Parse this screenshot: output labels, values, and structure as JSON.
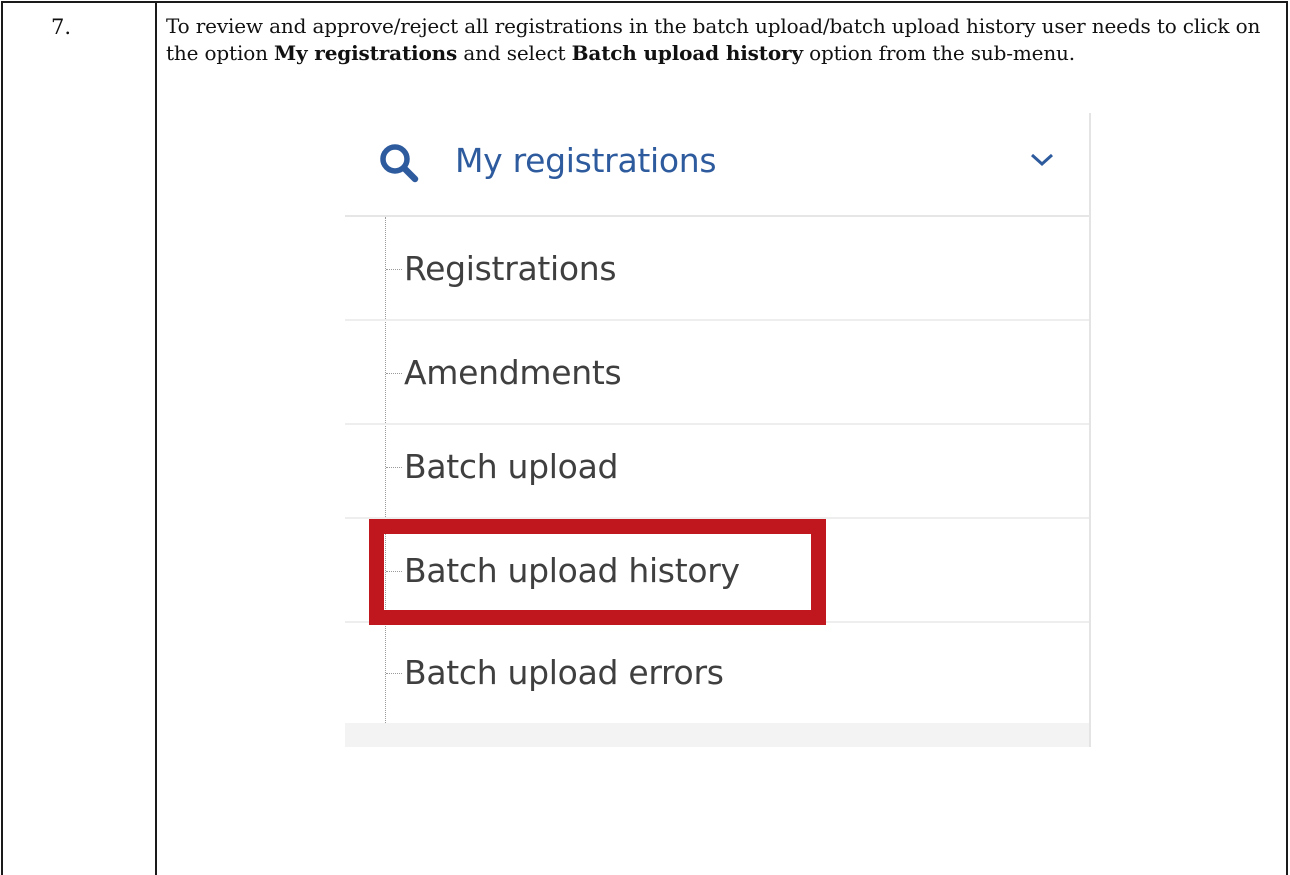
{
  "table": {
    "step_number": "7.",
    "instruction": {
      "text_1": "To review and approve/reject all registrations in the batch upload/batch upload history user needs to click on the option ",
      "bold_1": "My registrations",
      "text_2": " and select ",
      "bold_2": "Batch upload history",
      "text_3": " option from the sub-menu."
    }
  },
  "menu": {
    "title": "My registrations",
    "header_icon": "search-icon",
    "expand_icon": "chevron-down-icon",
    "title_color": "#2e5b9e",
    "items": [
      {
        "label": "Registrations"
      },
      {
        "label": "Amendments"
      },
      {
        "label": "Batch upload"
      },
      {
        "label": "Batch upload history",
        "highlighted": true
      },
      {
        "label": "Batch upload errors"
      }
    ],
    "highlight_color": "#c0161d"
  }
}
